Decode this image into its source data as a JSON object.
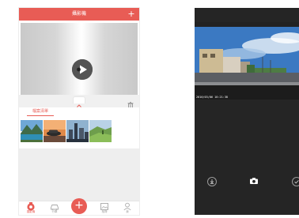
{
  "left_screen": {
    "header": {
      "title": "攝影機",
      "add_symbol": "+"
    },
    "player": {
      "play_icon": "play-icon"
    },
    "tabs": [
      {
        "label": "檔案清單",
        "active": true
      }
    ],
    "thumbnails": [
      {
        "subject": "mountain-lake"
      },
      {
        "subject": "car-road"
      },
      {
        "subject": "city-tower"
      },
      {
        "subject": "hillside"
      }
    ],
    "bottom_nav": [
      {
        "label": "攝影機",
        "icon": "camera-icon",
        "active": true
      },
      {
        "label": "行車",
        "icon": "car-icon"
      },
      {
        "label": "",
        "icon": "plus-icon"
      },
      {
        "label": "相簿",
        "icon": "album-icon"
      },
      {
        "label": "我",
        "icon": "person-icon"
      }
    ],
    "accent_color": "#e85c55"
  },
  "right_screen": {
    "overlay_text": "2016/03/06 10:21:38",
    "controls": [
      {
        "icon": "download-icon"
      },
      {
        "icon": "camera-shutter-icon"
      },
      {
        "icon": "check-icon"
      }
    ],
    "background_color": "#252525"
  }
}
